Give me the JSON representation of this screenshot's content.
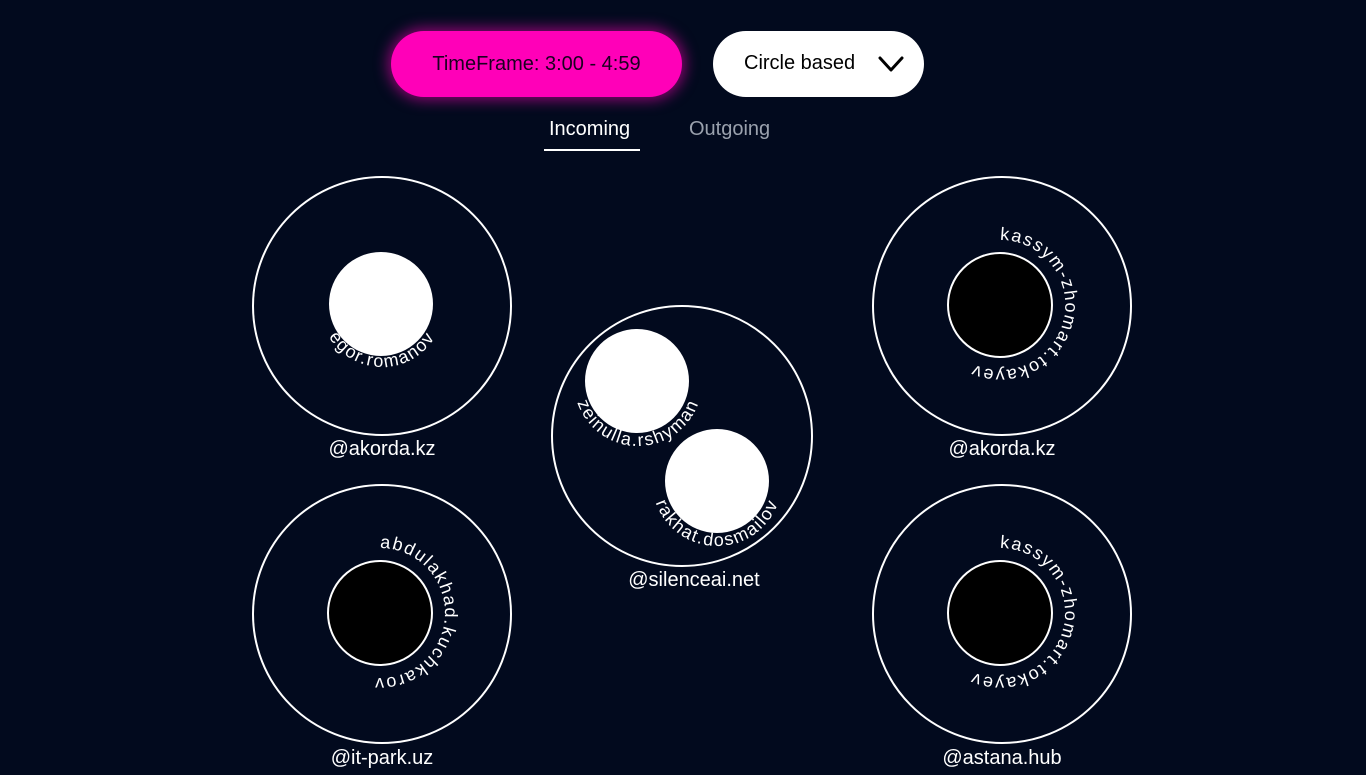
{
  "toolbar": {
    "timeframe_label": "TimeFrame: 3:00 - 4:59",
    "mode_label": "Circle based",
    "chevron_icon": "chevron-down-icon",
    "accent_color": "#ff00b8"
  },
  "tabs": [
    {
      "label": "Incoming",
      "active": true
    },
    {
      "label": "Outgoing",
      "active": false
    }
  ],
  "groups": [
    {
      "domain": "@akorda.kz",
      "members": [
        {
          "name": "egor.romanov",
          "filled": "white"
        }
      ]
    },
    {
      "domain": "@silenceai.net",
      "members": [
        {
          "name": "zeinulla.rshyman",
          "filled": "white"
        },
        {
          "name": "rakhat.dosmailov",
          "filled": "white"
        }
      ]
    },
    {
      "domain": "@akorda.kz",
      "members": [
        {
          "name": "kassym-zhomart.tokayev",
          "filled": "black"
        }
      ]
    },
    {
      "domain": "@it-park.uz",
      "members": [
        {
          "name": "abdulakhad.kuchkarov",
          "filled": "black"
        }
      ]
    },
    {
      "domain": "@astana.hub",
      "members": [
        {
          "name": "kassym-zhomart.tokayev",
          "filled": "black"
        }
      ]
    }
  ]
}
